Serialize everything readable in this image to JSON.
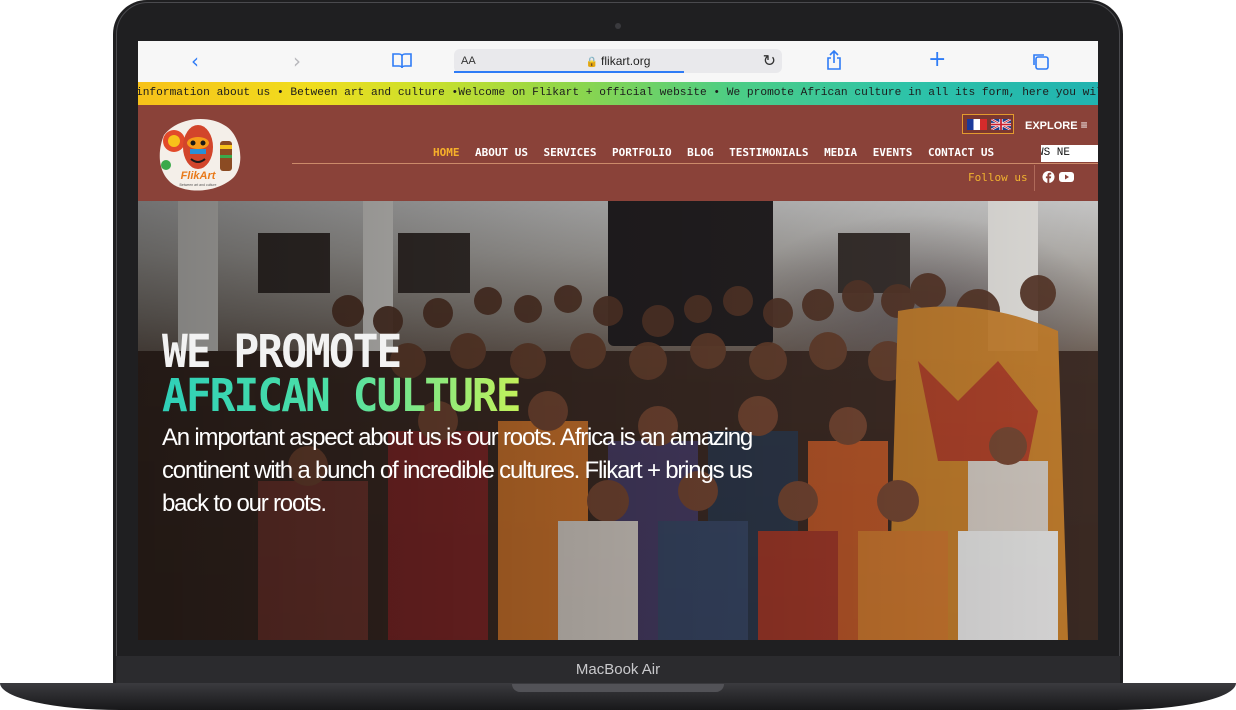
{
  "device": {
    "brand": "MacBook Air"
  },
  "browser": {
    "address_aa": "AA",
    "url": "flikart.org",
    "back_icon": "chevron-left-icon",
    "forward_icon": "chevron-right-icon",
    "bookmarks_icon": "book-icon",
    "reload_icon": "reload-icon",
    "share_icon": "share-icon",
    "new_tab_icon": "plus-icon",
    "tabs_icon": "tabs-icon"
  },
  "marquee": {
    "text": "information about us • Between art and culture •Welcome on Flikart + official website • We promote African culture in all its form, here you will have all"
  },
  "header": {
    "logo_alt": "FlikArt",
    "logo_name": "FlikArt",
    "logo_tagline": "Between art and culture",
    "explore_label": "EXPLORE",
    "nav": [
      {
        "label": "HOME",
        "active": true
      },
      {
        "label": "ABOUT US"
      },
      {
        "label": "SERVICES"
      },
      {
        "label": "PORTFOLIO"
      },
      {
        "label": "BLOG"
      },
      {
        "label": "TESTIMONIALS"
      },
      {
        "label": "MEDIA"
      },
      {
        "label": "EVENTS"
      },
      {
        "label": "CONTACT US"
      }
    ],
    "news_ticker": "WS  NE",
    "follow_label": "Follow us",
    "social": [
      "facebook-icon",
      "youtube-icon"
    ]
  },
  "hero": {
    "title_line1": "WE PROMOTE",
    "title_line2": "AFRICAN CULTURE",
    "body": "An important aspect about us is our roots. Africa is an amazing continent with a bunch of incredible cultures. Flikart + brings us back to our roots."
  },
  "colors": {
    "header_bg": "#8a4239",
    "nav_active": "#f7b12a",
    "follow": "#f0b230",
    "accent_blue": "#2f7cf6"
  }
}
